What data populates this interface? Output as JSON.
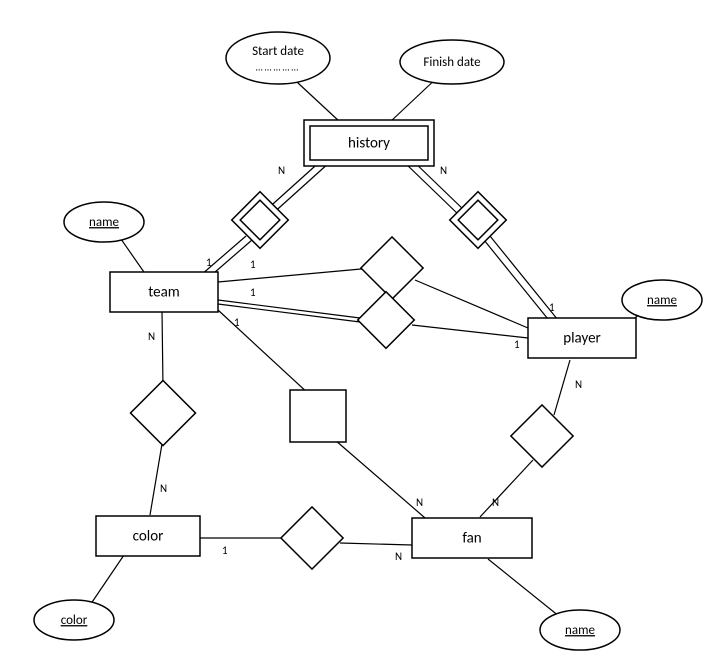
{
  "entities": {
    "history": {
      "label": "history",
      "weak": true
    },
    "team": {
      "label": "team",
      "weak": false
    },
    "player": {
      "label": "player",
      "weak": false
    },
    "color": {
      "label": "color",
      "weak": false
    },
    "fan": {
      "label": "fan",
      "weak": false
    }
  },
  "attributes": {
    "start_date": {
      "label": "Start date",
      "key": false,
      "extra": "……………"
    },
    "finish_date": {
      "label": "Finish date",
      "key": false
    },
    "team_name": {
      "label": "name",
      "key": true
    },
    "player_name": {
      "label": "name",
      "key": true
    },
    "fan_name": {
      "label": "name",
      "key": true
    },
    "color_color": {
      "label": "color",
      "key": true
    }
  },
  "relationships": {
    "team_history": {
      "identifying": true
    },
    "player_history": {
      "identifying": true
    },
    "team_player_a": {
      "identifying": false
    },
    "team_player_b": {
      "identifying": false
    },
    "team_color": {
      "identifying": false
    },
    "team_fan": {
      "identifying": false
    },
    "color_fan": {
      "identifying": false
    },
    "player_fan": {
      "identifying": false
    }
  },
  "cardinalities": {
    "history_team_side": "N",
    "history_player_side": "N",
    "team_to_history": "1",
    "team_to_player_a": "1",
    "team_to_player_b": "1",
    "team_to_fan": "1",
    "team_to_color": "N",
    "player_to_team_a": "1",
    "player_to_team_b": "1",
    "player_to_history": "1",
    "player_to_fan": "N",
    "color_to_team": "N",
    "color_to_fan": "1",
    "fan_to_team": "N",
    "fan_to_player": "N",
    "fan_to_color": "N"
  }
}
